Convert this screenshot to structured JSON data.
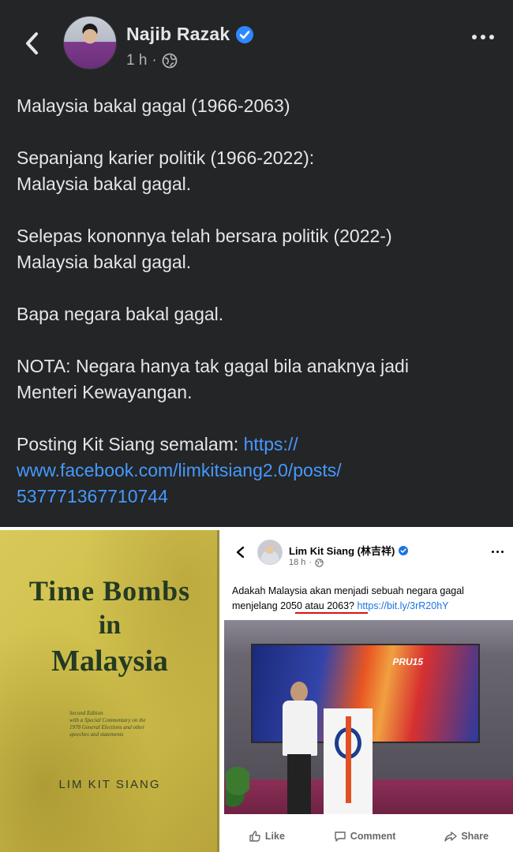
{
  "post": {
    "author": "Najib Razak",
    "time": "1 h",
    "separator": "·",
    "paragraphs": [
      [
        "Malaysia bakal gagal (1966-2063)"
      ],
      [
        "Sepanjang karier politik (1966-2022):",
        "Malaysia bakal gagal."
      ],
      [
        "Selepas kononnya telah bersara politik (2022-)",
        "Malaysia bakal gagal."
      ],
      [
        "Bapa negara bakal gagal."
      ],
      [
        "NOTA: Negara hanya tak gagal bila anaknya jadi",
        "Menteri Kewayangan."
      ]
    ],
    "last_line_prefix": "Posting Kit Siang semalam: ",
    "link_lines": [
      "https://",
      "www.facebook.com/limkitsiang2.0/posts/",
      "537771367710744"
    ]
  },
  "book": {
    "title_lines": [
      "Time Bombs",
      "in",
      "Malaysia"
    ],
    "edition_lines": [
      "Second Edition",
      "with a Special Commentary on the",
      "1978 General Elections and other",
      "speeches and statements"
    ],
    "author": "LIM KIT SIANG"
  },
  "embedded": {
    "author": "Lim Kit Siang (林吉祥)",
    "time": "18 h",
    "separator": "·",
    "text_lines": [
      "Adakah Malaysia akan menjadi sebuah negara gagal",
      "menjelang 2050 atau 2063? "
    ],
    "link": "https://bit.ly/3rR20hY",
    "screen_label": "PRU15",
    "actions": {
      "like": "Like",
      "comment": "Comment",
      "share": "Share"
    }
  },
  "colors": {
    "background": "#242526",
    "text": "#e4e6eb",
    "link": "#4599ff",
    "verified": "#2d88ff"
  }
}
